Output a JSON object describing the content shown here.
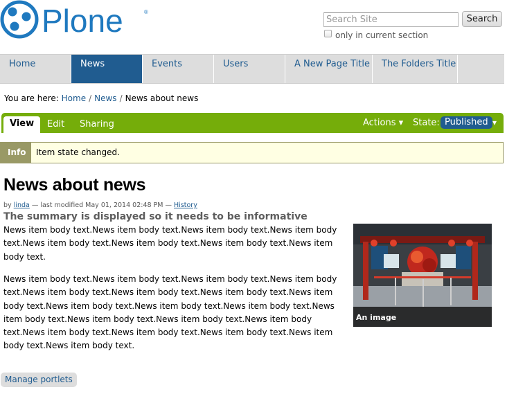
{
  "header": {
    "logo_text": "Plone",
    "search": {
      "placeholder": "Search Site",
      "button_label": "Search",
      "checkbox_label": "only in current section"
    }
  },
  "nav": {
    "tabs": [
      {
        "label": "Home",
        "selected": false
      },
      {
        "label": "News",
        "selected": true
      },
      {
        "label": "Events",
        "selected": false
      },
      {
        "label": "Users",
        "selected": false
      },
      {
        "label": "A New Page Title",
        "selected": false
      },
      {
        "label": "The Folders Title",
        "selected": false
      }
    ]
  },
  "breadcrumb": {
    "prefix": "You are here:",
    "items": [
      "Home",
      "News",
      "News about news"
    ]
  },
  "edit_bar": {
    "tabs": [
      "View",
      "Edit",
      "Sharing"
    ],
    "active_tab": "View",
    "actions_label": "Actions ▾",
    "state_label": "State:",
    "state_value": "Published",
    "state_caret": "▾"
  },
  "info": {
    "badge": "Info",
    "message": "Item state changed."
  },
  "content": {
    "title": "News about news",
    "byline": {
      "by": "by",
      "author": "linda",
      "modified": "— last modified May 01, 2014 02:48 PM —",
      "history": "History"
    },
    "summary": "The summary is displayed so it needs to be informative",
    "paragraphs": [
      "News item body text.News item body text.News item body text.News item body text.News item body text.News item body text.News item body text.News item body text.",
      "News item body text.News item body text.News item body text.News item body text.News item body text.News item body text.News item body text.News item body text.News item body text.News item body text.News item body text.News item body text.News item body text.News item body text.News item body text.News item body text.News item body text.News item body text.News item body text.News item body text."
    ],
    "image_caption": "An image"
  },
  "footer": {
    "manage_portlets": "Manage portlets"
  },
  "colors": {
    "brand_blue": "#205c90",
    "edit_bar_green": "#75ad0a",
    "info_olive": "#999966",
    "nav_gray": "#dddddd"
  }
}
